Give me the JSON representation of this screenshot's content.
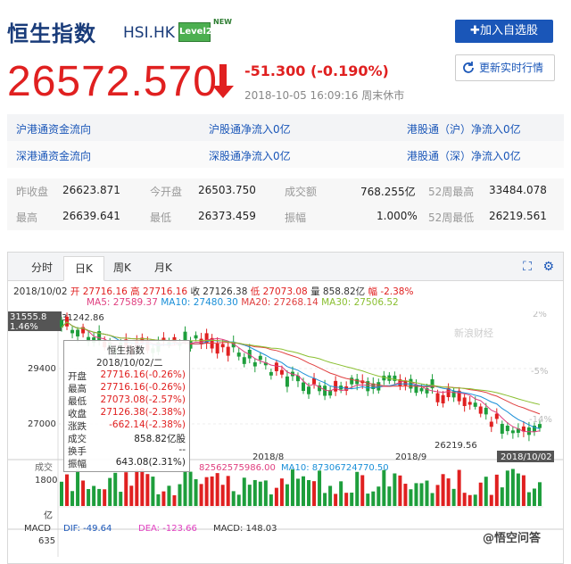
{
  "header": {
    "name": "恒生指数",
    "code": "HSI.HK",
    "badge": "Level2",
    "badge_new": "NEW",
    "add_button": "加入自选股"
  },
  "quote": {
    "price": "26572.570",
    "change": "-51.300 (-0.190%)",
    "timestamp": "2018-10-05 16:09:16  周末休市",
    "refresh_button": "更新实时行情"
  },
  "flows": [
    {
      "a": "沪港通资金流向",
      "b": "沪股通净流入0亿",
      "c": "港股通（沪）净流入0亿"
    },
    {
      "a": "深港通资金流向",
      "b": "深股通净流入0亿",
      "c": "港股通（深）净流入0亿"
    }
  ],
  "stats": {
    "prev_close_label": "昨收盘",
    "prev_close": "26623.871",
    "open_label": "今开盘",
    "open": "26503.750",
    "volume_label": "成交额",
    "volume": "768.255亿",
    "high52_label": "52周最高",
    "high52": "33484.078",
    "high_label": "最高",
    "high": "26639.641",
    "low_label": "最低",
    "low": "26373.459",
    "amp_label": "振幅",
    "amp": "1.000%",
    "low52_label": "52周最低",
    "low52": "26219.561"
  },
  "tabs": [
    "分时",
    "日K",
    "周K",
    "月K"
  ],
  "active_tab": "日K",
  "ohlc_line": {
    "date": "2018/10/02",
    "open": "开 27716.16",
    "high": "高 27716.16",
    "close": "收 27126.38",
    "low": "低 27073.08",
    "vol": "量 858.82亿",
    "pct": "幅 -2.38%"
  },
  "ma_line": {
    "ma5": "MA5: 27589.37",
    "ma10": "MA10: 27480.30",
    "ma20": "MA20: 27268.14",
    "ma30": "MA30: 27506.52"
  },
  "tooltip": {
    "title": "恒生指数",
    "date": "2018/10/02/二",
    "rows": [
      {
        "k": "开盘",
        "v": "27716.16(-0.26%)"
      },
      {
        "k": "最高",
        "v": "27716.16(-0.26%)"
      },
      {
        "k": "最低",
        "v": "27073.08(-2.57%)"
      },
      {
        "k": "收盘",
        "v": "27126.38(-2.38%)"
      },
      {
        "k": "涨跌",
        "v": "-662.14(-2.38%)"
      },
      {
        "k": "成交",
        "v": "858.82亿股"
      },
      {
        "k": "换手",
        "v": "--"
      },
      {
        "k": "振幅",
        "v": "643.08(2.31%)"
      }
    ]
  },
  "chart_labels": {
    "y_top": "31555.8",
    "y_top_pct": "1.46%",
    "peak": "31242.86",
    "y_mid": "29400",
    "y_low": "27000",
    "pct_2": "2%",
    "pct_5": "-5%",
    "pct_14": "-14%",
    "x_aug": "2018/8",
    "x_sep": "2018/9",
    "x_last": "2018/10/02",
    "trough": "26219.56",
    "watermark": "新浪财经",
    "vol_label": "成交",
    "vol_ma5": "82562575986.00",
    "vol_ma10": "MA10: 87306724770.50",
    "vol_y": "1800",
    "vol_unit": "亿",
    "macd_label": "MACD",
    "dif": "DIF: -49.64",
    "dea": "DEA: -123.66",
    "macd": "MACD: 148.03",
    "macd_y": "635",
    "footer": "@悟空问答"
  },
  "colors": {
    "up": "#e02020",
    "down": "#1e9e3c",
    "accent": "#1a56b8"
  }
}
